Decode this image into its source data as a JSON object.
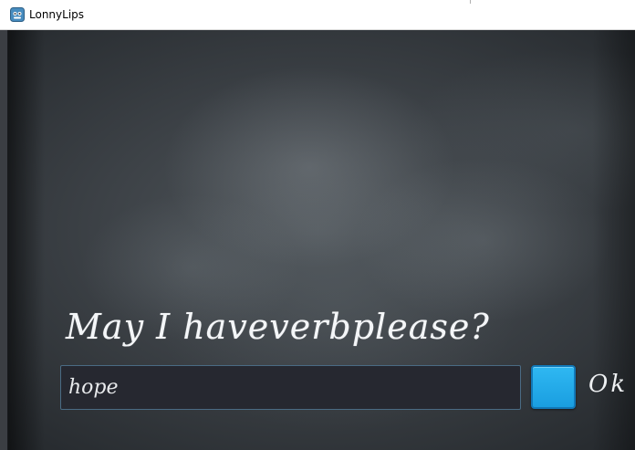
{
  "window": {
    "title": "LonnyLips",
    "icon": "game-engine-app-icon"
  },
  "game": {
    "prompt": "May I haveverbplease?",
    "input_value": "hope",
    "ok_label": "Ok"
  },
  "colors": {
    "button_fill": "#1fa9ea",
    "input_border": "#4a6b84",
    "chalk_text": "#f4f6f8"
  }
}
